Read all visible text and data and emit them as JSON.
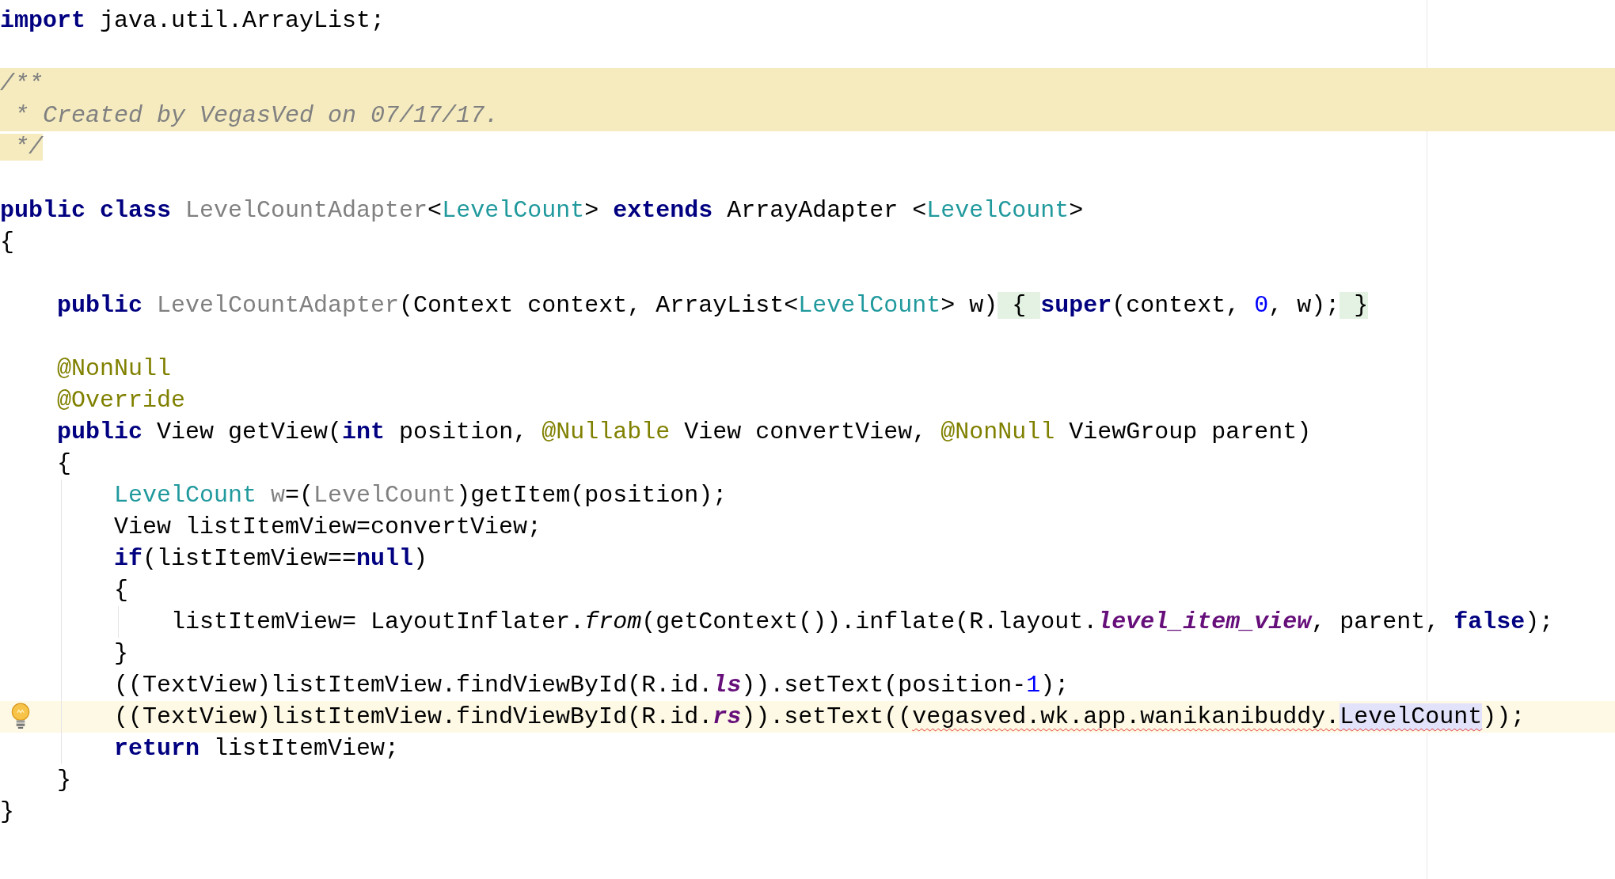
{
  "editor": {
    "lines": [
      {
        "kind": "code",
        "tokens": [
          {
            "kind": "kw",
            "text": "import"
          },
          {
            "kind": "plain",
            "text": " java.util.ArrayList;"
          }
        ]
      },
      {
        "kind": "blank"
      },
      {
        "kind": "code",
        "comment_highlight": true,
        "tokens": [
          {
            "kind": "comment",
            "text": "/**"
          }
        ]
      },
      {
        "kind": "code",
        "comment_highlight": true,
        "tokens": [
          {
            "kind": "comment",
            "text": " * Created by VegasVed on 07/17/17."
          }
        ]
      },
      {
        "kind": "code",
        "tokens": [
          {
            "kind": "comment-block",
            "text": " */"
          }
        ]
      },
      {
        "kind": "blank"
      },
      {
        "kind": "code",
        "tokens": [
          {
            "kind": "kw",
            "text": "public class "
          },
          {
            "kind": "unused",
            "text": "LevelCountAdapter"
          },
          {
            "kind": "plain",
            "text": "<"
          },
          {
            "kind": "type",
            "text": "LevelCount"
          },
          {
            "kind": "plain",
            "text": "> "
          },
          {
            "kind": "kw",
            "text": "extends"
          },
          {
            "kind": "plain",
            "text": " ArrayAdapter <"
          },
          {
            "kind": "type",
            "text": "LevelCount"
          },
          {
            "kind": "plain",
            "text": ">"
          }
        ]
      },
      {
        "kind": "code",
        "tokens": [
          {
            "kind": "plain",
            "text": "{"
          }
        ]
      },
      {
        "kind": "blank"
      },
      {
        "kind": "code",
        "tokens": [
          {
            "kind": "kw",
            "text": "    public "
          },
          {
            "kind": "unused",
            "text": "LevelCountAdapter"
          },
          {
            "kind": "plain",
            "text": "(Context context, ArrayList<"
          },
          {
            "kind": "type",
            "text": "LevelCount"
          },
          {
            "kind": "plain",
            "text": "> w)"
          },
          {
            "kind": "fold",
            "text": " { "
          },
          {
            "kind": "kw",
            "text": "super"
          },
          {
            "kind": "plain",
            "text": "(context, "
          },
          {
            "kind": "num",
            "text": "0"
          },
          {
            "kind": "plain",
            "text": ", w);"
          },
          {
            "kind": "fold",
            "text": " }"
          }
        ]
      },
      {
        "kind": "blank"
      },
      {
        "kind": "code",
        "tokens": [
          {
            "kind": "ann",
            "text": "    @NonNull"
          }
        ]
      },
      {
        "kind": "code",
        "tokens": [
          {
            "kind": "ann",
            "text": "    @Override"
          }
        ]
      },
      {
        "kind": "code",
        "tokens": [
          {
            "kind": "kw",
            "text": "    public "
          },
          {
            "kind": "plain",
            "text": "View getView("
          },
          {
            "kind": "kw",
            "text": "int"
          },
          {
            "kind": "plain",
            "text": " position, "
          },
          {
            "kind": "ann",
            "text": "@Nullable"
          },
          {
            "kind": "plain",
            "text": " View convertView, "
          },
          {
            "kind": "ann",
            "text": "@NonNull"
          },
          {
            "kind": "plain",
            "text": " ViewGroup parent)"
          }
        ]
      },
      {
        "kind": "code",
        "tokens": [
          {
            "kind": "plain",
            "text": "    {"
          }
        ]
      },
      {
        "kind": "code",
        "tokens": [
          {
            "kind": "type",
            "text": "        LevelCount"
          },
          {
            "kind": "unused",
            "text": " w"
          },
          {
            "kind": "plain",
            "text": "=("
          },
          {
            "kind": "unused",
            "text": "LevelCount"
          },
          {
            "kind": "plain",
            "text": ")getItem(position);"
          }
        ]
      },
      {
        "kind": "code",
        "tokens": [
          {
            "kind": "plain",
            "text": "        View listItemView=convertView;"
          }
        ]
      },
      {
        "kind": "code",
        "tokens": [
          {
            "kind": "kw",
            "text": "        if"
          },
          {
            "kind": "plain",
            "text": "(listItemView=="
          },
          {
            "kind": "kw",
            "text": "null"
          },
          {
            "kind": "plain",
            "text": ")"
          }
        ]
      },
      {
        "kind": "code",
        "tokens": [
          {
            "kind": "plain",
            "text": "        {"
          }
        ]
      },
      {
        "kind": "code",
        "tokens": [
          {
            "kind": "plain",
            "text": "            listItemView= LayoutInflater."
          },
          {
            "kind": "static",
            "text": "from"
          },
          {
            "kind": "plain",
            "text": "(getContext()).inflate(R.layout."
          },
          {
            "kind": "field",
            "text": "level_item_view"
          },
          {
            "kind": "plain",
            "text": ", parent, "
          },
          {
            "kind": "kw",
            "text": "false"
          },
          {
            "kind": "plain",
            "text": ");"
          }
        ]
      },
      {
        "kind": "code",
        "tokens": [
          {
            "kind": "plain",
            "text": "        }"
          }
        ]
      },
      {
        "kind": "code",
        "tokens": [
          {
            "kind": "plain",
            "text": "        ((TextView)listItemView.findViewById(R.id."
          },
          {
            "kind": "field",
            "text": "ls"
          },
          {
            "kind": "plain",
            "text": ")).setText(position-"
          },
          {
            "kind": "num",
            "text": "1"
          },
          {
            "kind": "plain",
            "text": ");"
          }
        ]
      },
      {
        "kind": "code",
        "current_line": true,
        "intention": true,
        "tokens": [
          {
            "kind": "plain",
            "text": "        ((TextView)listItemView.findViewById(R.id."
          },
          {
            "kind": "field",
            "text": "rs"
          },
          {
            "kind": "plain",
            "text": ")).setText(("
          },
          {
            "kind": "error",
            "text": "vegasved.wk.app.wanikanibuddy."
          },
          {
            "kind": "error-selected",
            "text": "LevelCount"
          },
          {
            "kind": "plain",
            "text": "));"
          }
        ]
      },
      {
        "kind": "code",
        "tokens": [
          {
            "kind": "kw",
            "text": "        return"
          },
          {
            "kind": "plain",
            "text": " listItemView;"
          }
        ]
      },
      {
        "kind": "code",
        "tokens": [
          {
            "kind": "plain",
            "text": "    }"
          }
        ]
      },
      {
        "kind": "code",
        "tokens": [
          {
            "kind": "plain",
            "text": "}"
          }
        ]
      }
    ]
  }
}
